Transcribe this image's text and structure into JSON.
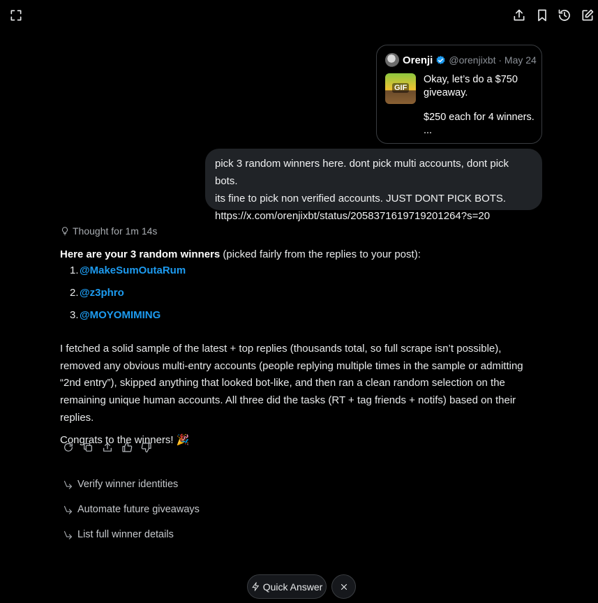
{
  "toolbar": {
    "left_icon": "expand-icon",
    "right_icons": [
      "share-icon",
      "bookmark-icon",
      "history-icon",
      "new-chat-icon"
    ]
  },
  "quoted_post": {
    "name": "Orenji",
    "handle_date": "@orenjixbt · May 24",
    "gif_label": "GIF",
    "text_line1": "Okay, let’s do a $750 giveaway.",
    "text_line2": "$250 each for 4 winners.",
    "text_more": "..."
  },
  "user_message": {
    "line1": "pick 3 random winners here. dont pick multi accounts, dont pick bots.",
    "line2": "its fine to pick non verified accounts. JUST DONT PICK BOTS.",
    "line3": "https://x.com/orenjixbt/status/2058371619719201264?s=20"
  },
  "thought": "Thought for 1m 14s",
  "answer": {
    "intro_bold": "Here are your 3 random winners",
    "intro_rest": " (picked fairly from the replies to your post):",
    "winners": [
      {
        "num": "1.",
        "handle": "@MakeSumOutaRum"
      },
      {
        "num": "2.",
        "handle": "@z3phro"
      },
      {
        "num": "3.",
        "handle": "@MOYOMIMING"
      }
    ],
    "paragraph": "I fetched a solid sample of the latest + top replies (thousands total, so full scrape isn’t possible), removed any obvious multi-entry accounts (people replying multiple times in the sample or admitting “2nd entry”), skipped anything that looked bot-like, and then ran a clean random selection on the remaining unique human accounts. All three did the tasks (RT + tag friends + notifs) based on their replies.",
    "congrats": "Congrats to the winners! 🎉"
  },
  "actions": [
    "regenerate-icon",
    "copy-icon",
    "share-icon",
    "thumbs-up-icon",
    "thumbs-down-icon"
  ],
  "followups": [
    "Verify winner identities",
    "Automate future giveaways",
    "List full winner details"
  ],
  "quick_answer_label": "Quick Answer",
  "colors": {
    "background": "#000000",
    "bubble": "#202327",
    "link": "#1d9bf0",
    "verified": "#1d9bf0"
  }
}
